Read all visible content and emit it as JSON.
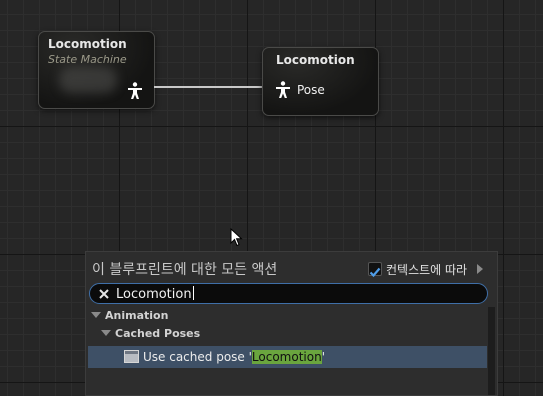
{
  "state_machine_node": {
    "title": "Locomotion",
    "subtitle": "State Machine",
    "output_pin_icon": "pose-pin-icon"
  },
  "pose_node": {
    "title": "Locomotion",
    "pin_label": "Pose",
    "input_pin_icon": "pose-pin-icon"
  },
  "action_menu": {
    "title": "이 블루프린트에 대한 모든 액션",
    "context_sensitive_label": "컨텍스트에 따라",
    "context_sensitive_checked": true,
    "search": {
      "value": "Locomotion",
      "clear_icon": "close-icon"
    },
    "tree": {
      "category": "Animation",
      "subcategory": "Cached Poses",
      "action_prefix": "Use cached pose '",
      "action_match": "Locomotion",
      "action_suffix": "'",
      "action_icon": "function-icon"
    }
  },
  "colors": {
    "accent": "#3f6fa8",
    "checkbox_check": "#4f9de8",
    "selection": "#3e5066",
    "match_highlight": "#6aa53e",
    "subtitle": "#9c9a8a"
  }
}
